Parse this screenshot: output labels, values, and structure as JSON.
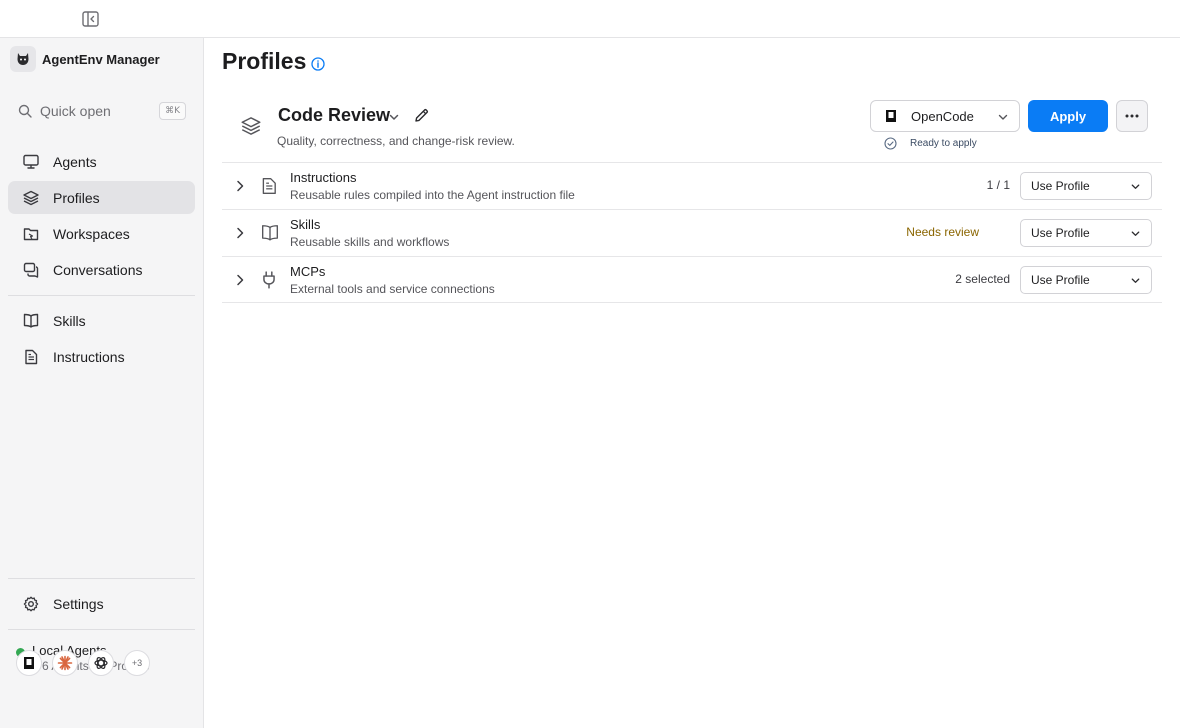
{
  "app": {
    "name": "AgentEnv Manager"
  },
  "sidebar": {
    "quick_open": {
      "label": "Quick open",
      "shortcut": "⌘K"
    },
    "nav": [
      {
        "label": "Agents",
        "icon": "monitor-icon"
      },
      {
        "label": "Profiles",
        "icon": "layers-icon",
        "active": true
      },
      {
        "label": "Workspaces",
        "icon": "workspace-icon"
      },
      {
        "label": "Conversations",
        "icon": "chat-icon"
      },
      {
        "label": "Skills",
        "icon": "book-icon"
      },
      {
        "label": "Instructions",
        "icon": "document-icon"
      }
    ],
    "settings": {
      "label": "Settings",
      "icon": "gear-icon"
    },
    "local_agents": {
      "title": "Local Agents",
      "subtitle": "6/6 Agents · 4 Profiles",
      "status_color": "#34a853",
      "extra_count": "+3"
    }
  },
  "main": {
    "title": "Profiles",
    "profile": {
      "name": "Code Review",
      "description": "Quality, correctness, and change-risk review."
    },
    "agent_select": {
      "value": "OpenCode",
      "status": "Ready to apply"
    },
    "apply_label": "Apply",
    "sections": [
      {
        "title": "Instructions",
        "description": "Reusable rules compiled into the Agent instruction file",
        "status": "1 /  1",
        "dropdown": "Use Profile"
      },
      {
        "title": "Skills",
        "description": "Reusable skills and workflows",
        "status": "Needs review",
        "dropdown": "Use Profile"
      },
      {
        "title": "MCPs",
        "description": "External tools and service connections",
        "status": "2 selected",
        "dropdown": "Use Profile"
      }
    ]
  },
  "colors": {
    "accent": "#0a7cf5",
    "warning": "#8a6500",
    "sidebar_bg": "#f5f5f6"
  }
}
